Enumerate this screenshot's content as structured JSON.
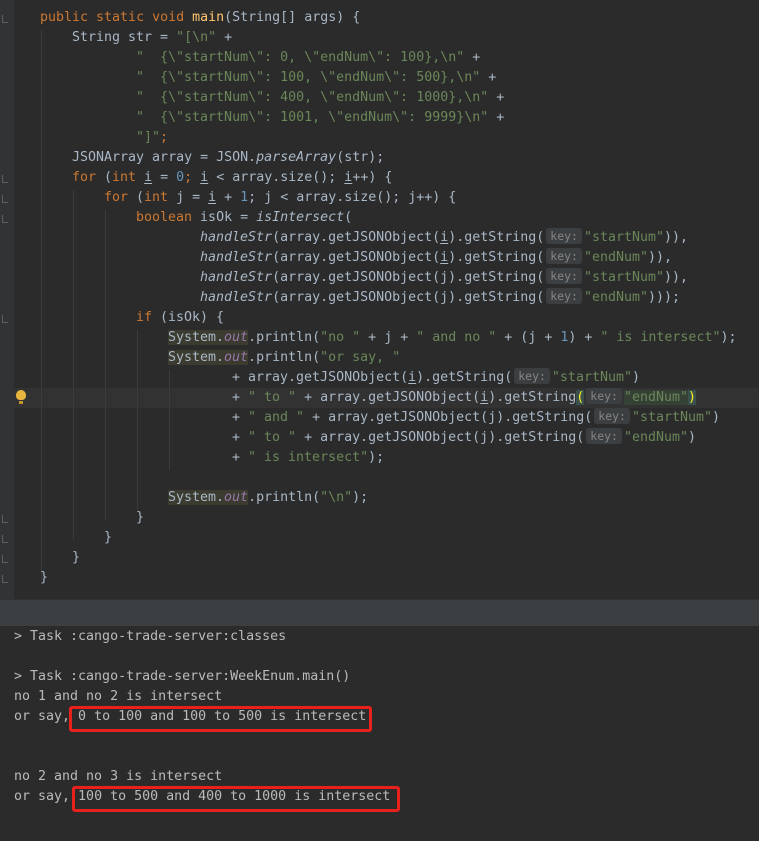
{
  "editor": {
    "line_main": {
      "kw1": "public static void ",
      "fn": "main",
      "rest": "(String[] args) {"
    },
    "line_str": {
      "pre": "String str = ",
      "s": "\"[\\n\"",
      "post": " +"
    },
    "line_r1": {
      "s": "\"  {\\\"startNum\\\": 0, \\\"endNum\\\": 100},\\n\"",
      "post": " +"
    },
    "line_r2": {
      "s": "\"  {\\\"startNum\\\": 100, \\\"endNum\\\": 500},\\n\"",
      "post": " +"
    },
    "line_r3": {
      "s": "\"  {\\\"startNum\\\": 400, \\\"endNum\\\": 1000},\\n\"",
      "post": " +"
    },
    "line_r4": {
      "s": "\"  {\\\"startNum\\\": 1001, \\\"endNum\\\": 9999}\\n\"",
      "post": " +"
    },
    "line_close": {
      "s": "\"]\"",
      "post": ";"
    },
    "line_arr": {
      "pre": "JSONArray array = JSON.",
      "m": "parseArray",
      "post": "(str);"
    },
    "line_for1": {
      "kw": "for",
      "a": " (",
      "kw2": "int",
      "b": " ",
      "v1": "i",
      "c": " = ",
      "n": "0",
      "d": "; ",
      "v2": "i",
      "e": " < array.size(); ",
      "v3": "i",
      "f": "++) {"
    },
    "line_for2": {
      "kw": "for",
      "a": " (",
      "kw2": "int",
      "b": " j = ",
      "v1": "i",
      "c": " + ",
      "n": "1",
      "d": "; j < array.size(); j++) {"
    },
    "line_bool": {
      "kw": "boolean",
      "a": " isOk = ",
      "m": "isIntersect",
      "b": "("
    },
    "line_h1": {
      "m": "handleStr",
      "a": "(array.getJSONObject(",
      "v": "i",
      "b": ").getString(",
      "hint": "key:",
      "s": "\"startNum\"",
      "c": ")),"
    },
    "line_h2": {
      "m": "handleStr",
      "a": "(array.getJSONObject(",
      "v": "i",
      "b": ").getString(",
      "hint": "key:",
      "s": "\"endNum\"",
      "c": ")),"
    },
    "line_h3": {
      "m": "handleStr",
      "a": "(array.getJSONObject(j).getString(",
      "hint": "key:",
      "s": "\"startNum\"",
      "c": ")),"
    },
    "line_h4": {
      "m": "handleStr",
      "a": "(array.getJSONObject(j).getString(",
      "hint": "key:",
      "s": "\"endNum\"",
      "c": ")));"
    },
    "line_if": {
      "kw": "if",
      "a": " (isOk) {"
    },
    "line_p1": {
      "sys": "System.",
      "out": "out",
      "a": ".println(",
      "s1": "\"no \"",
      "b": " + j + ",
      "s2": "\" and no \"",
      "c": " + (j + ",
      "n": "1",
      "d": ") + ",
      "s3": "\" is intersect\"",
      "e": ");"
    },
    "line_p2": {
      "sys": "System.",
      "out": "out",
      "a": ".println(",
      "s": "\"or say, \""
    },
    "line_p3": {
      "a": "+ array.getJSONObject(",
      "v": "i",
      "b": ").getString(",
      "hint": "key:",
      "s": "\"startNum\"",
      "c": ")"
    },
    "line_p4": {
      "a": "+ ",
      "s1": "\" to \"",
      "b": " + array.getJSONObject(",
      "v": "i",
      "c": ").getString",
      "p1": "(",
      "hint": "key:",
      "s2": "\"endNum\"",
      "p2": ")"
    },
    "line_p5": {
      "a": "+ ",
      "s1": "\" and \"",
      "b": " + array.getJSONObject(j).getString(",
      "hint": "key:",
      "s2": "\"startNum\"",
      "c": ")"
    },
    "line_p6": {
      "a": "+ ",
      "s1": "\" to \"",
      "b": " + array.getJSONObject(j).getString(",
      "hint": "key:",
      "s2": "\"endNum\"",
      "c": ")"
    },
    "line_p7": {
      "a": "+ ",
      "s": "\" is intersect\"",
      "b": ");"
    },
    "line_p8": {
      "sys": "System.",
      "out": "out",
      "a": ".println(",
      "s": "\"\\n\"",
      "b": ");"
    },
    "brace": "}"
  },
  "console": {
    "task1": "> Task :cango-trade-server:classes",
    "task2": "> Task :cango-trade-server:WeekEnum.main()",
    "out1": "no 1 and no 2 is intersect",
    "out2_prefix": "or say,",
    "out2_highlight": " 0 to 100 and 100 to 500 is intersect",
    "out3": "no 2 and no 3 is intersect",
    "out4_prefix": "or say,",
    "out4_highlight": " 100 to 500 and 400 to 1000 is intersect"
  },
  "colors": {
    "background": "#2b2b2b",
    "keyword": "#cc7832",
    "string": "#6a8759",
    "number": "#6897bb",
    "method": "#ffc66d",
    "field": "#9876aa",
    "highlight_box": "#e8211c"
  }
}
